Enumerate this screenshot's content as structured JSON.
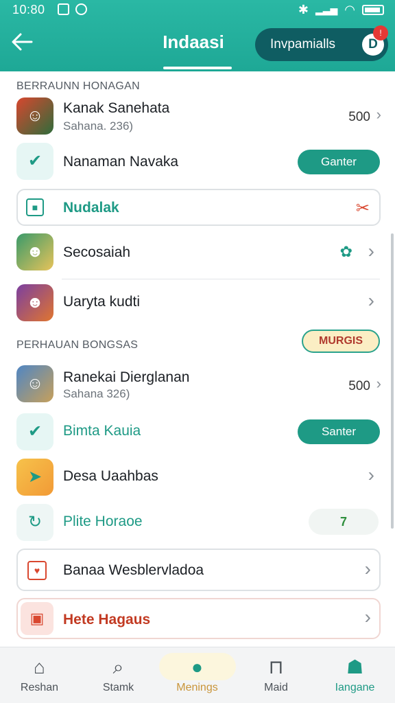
{
  "status": {
    "time": "10:80"
  },
  "header": {
    "back_icon": "arrow-left-icon",
    "title": "Indaasi",
    "pill_label": "Invpamialls",
    "pill_avatar": "D",
    "pill_badge": "!"
  },
  "section1": {
    "heading": "BERRAUNN HONAGAN",
    "items": [
      {
        "title": "Kanak Sanehata",
        "subtitle": "Sahana. 236)",
        "value": "500"
      },
      {
        "title": "Nanaman Navaka",
        "button": "Ganter"
      },
      {
        "title": "Nudalak"
      },
      {
        "title": "Secosaiah"
      },
      {
        "title": "Uaryta kudti"
      }
    ]
  },
  "section2": {
    "heading": "PERHAUAN BONGSAS",
    "badge": "MURGIS",
    "items": [
      {
        "title": "Ranekai Dierglanan",
        "subtitle": "Sahana 326)",
        "value": "500"
      },
      {
        "title": "Bimta Kauia",
        "button": "Santer"
      },
      {
        "title": "Desa Uaahbas"
      },
      {
        "title": "Plite Horaoe",
        "count": "7"
      },
      {
        "title": "Banaa Wesblervladoa"
      },
      {
        "title": "Hete Hagaus"
      }
    ]
  },
  "bottom_nav": [
    {
      "label": "Reshan",
      "icon": "home-icon"
    },
    {
      "label": "Stamk",
      "icon": "search-icon"
    },
    {
      "label": "Menings",
      "icon": "location-icon",
      "active": true
    },
    {
      "label": "Maid",
      "icon": "bag-icon"
    },
    {
      "label": "Iangane",
      "icon": "profile-icon"
    }
  ],
  "colors": {
    "header": "#1ea896",
    "accent": "#1e9a85",
    "dark_pill": "#0f5d62",
    "alert": "#e53935"
  }
}
